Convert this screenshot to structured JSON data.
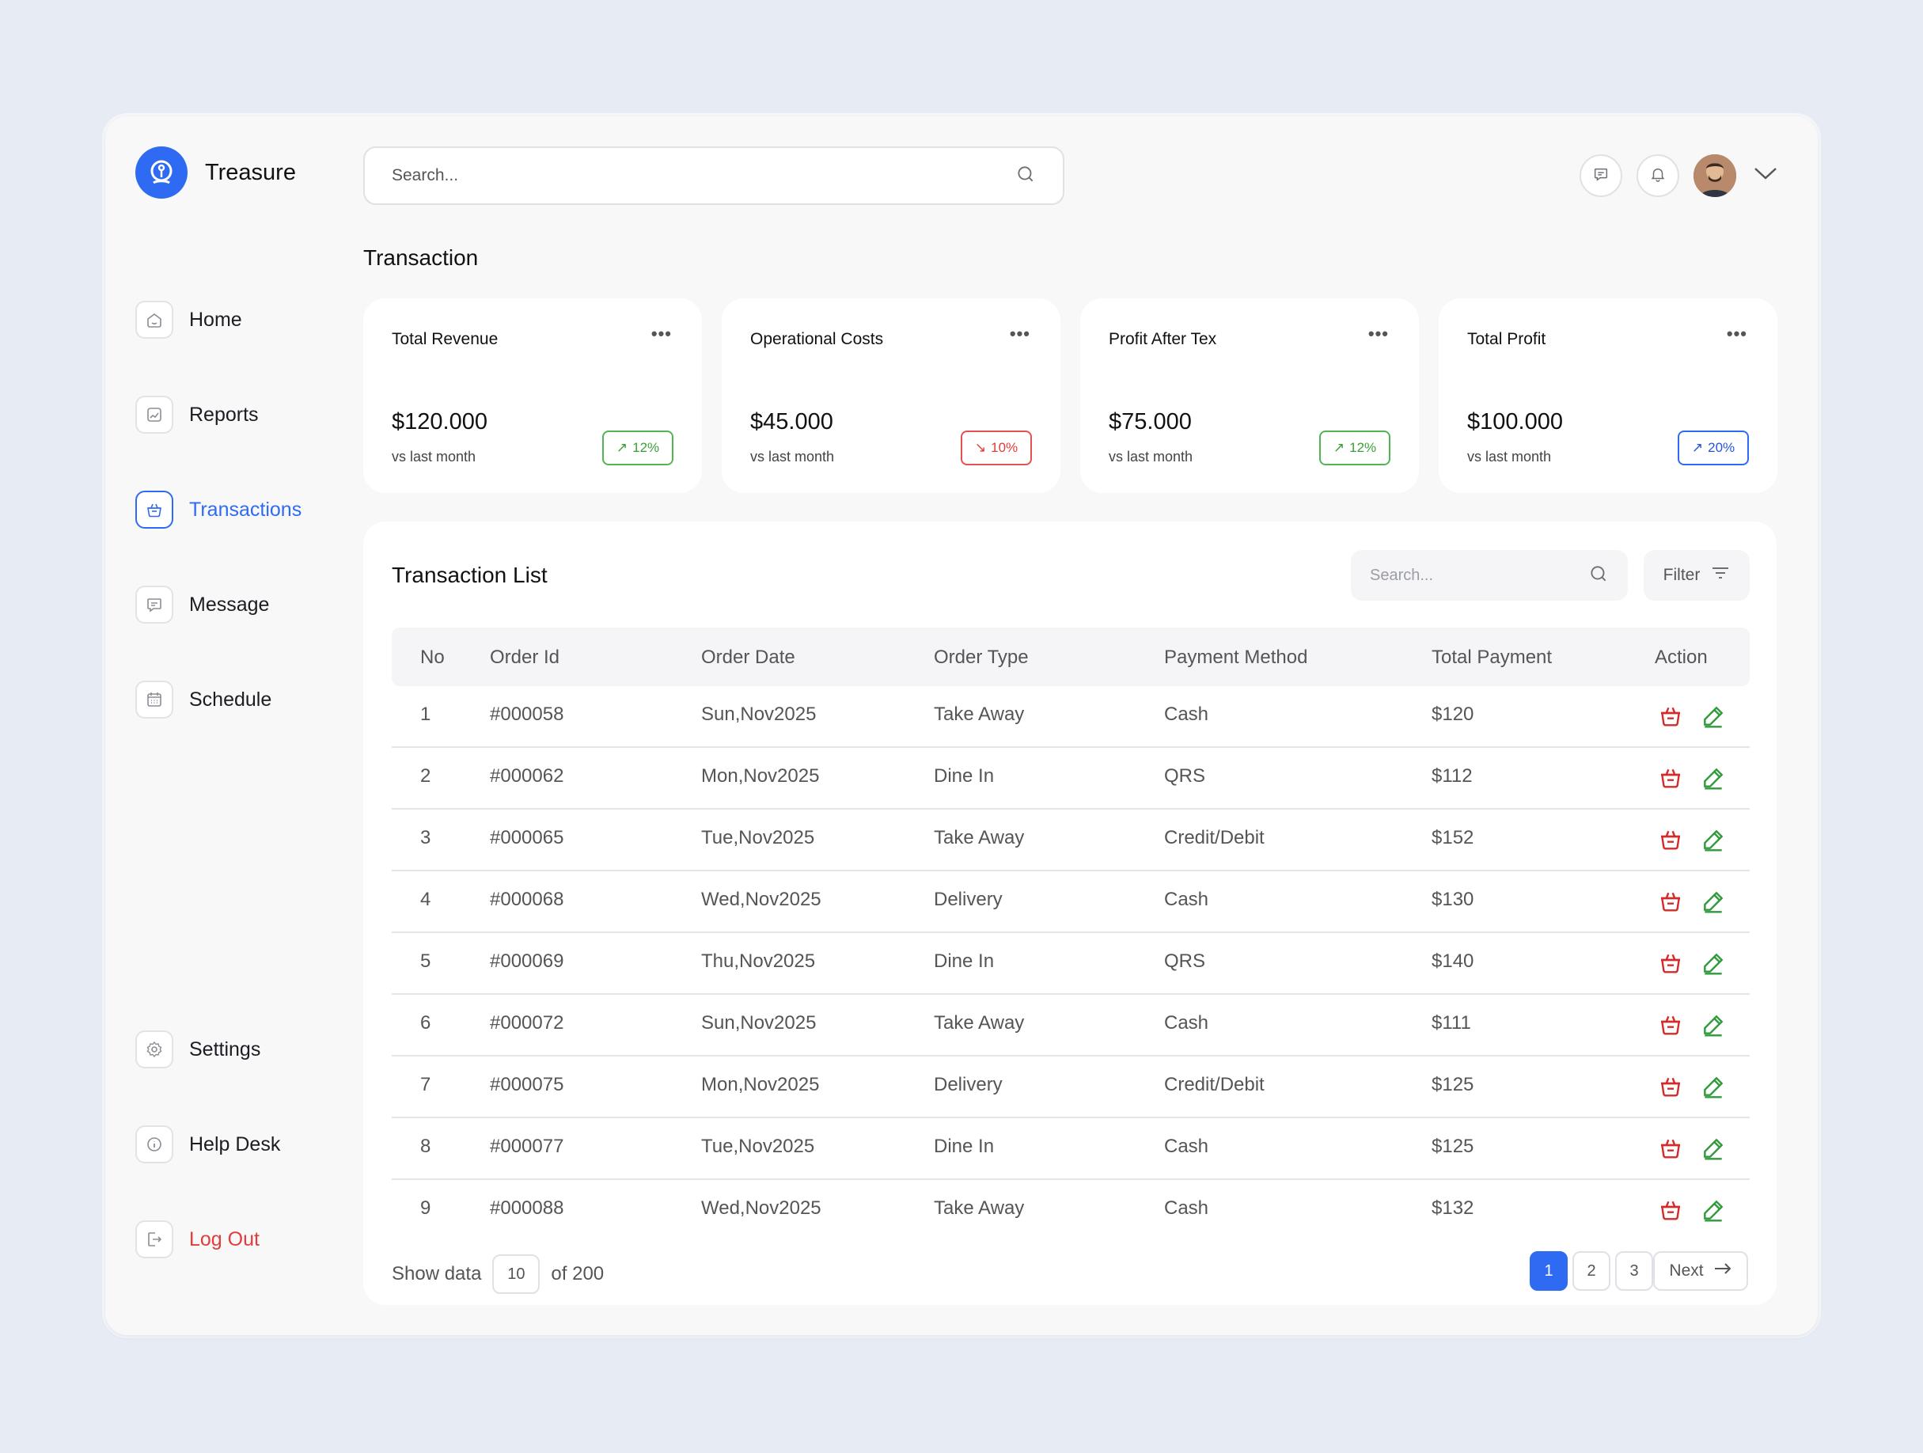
{
  "app": {
    "name": "Treasure"
  },
  "search": {
    "placeholder": "Search..."
  },
  "sidebar": {
    "items": [
      {
        "label": "Home"
      },
      {
        "label": "Reports"
      },
      {
        "label": "Transactions"
      },
      {
        "label": "Message"
      },
      {
        "label": "Schedule"
      },
      {
        "label": "Settings"
      },
      {
        "label": "Help Desk"
      },
      {
        "label": "Log Out"
      }
    ],
    "active": "Transactions"
  },
  "page": {
    "title": "Transaction"
  },
  "cards": [
    {
      "title": "Total Revenue",
      "value": "$120.000",
      "sub": "vs last month",
      "change": "12%",
      "trend": "up",
      "color": "#3aa13a"
    },
    {
      "title": "Operational Costs",
      "value": "$45.000",
      "sub": "vs last month",
      "change": "10%",
      "trend": "down",
      "color": "#e23b3b"
    },
    {
      "title": "Profit After Tex",
      "value": "$75.000",
      "sub": "vs last month",
      "change": "12%",
      "trend": "up",
      "color": "#3aa13a"
    },
    {
      "title": "Total Profit",
      "value": "$100.000",
      "sub": "vs last month",
      "change": "20%",
      "trend": "up",
      "color": "#2556d8"
    }
  ],
  "list": {
    "title": "Transaction List",
    "search_placeholder": "Search...",
    "filter_label": "Filter",
    "columns": [
      "No",
      "Order Id",
      "Order Date",
      "Order Type",
      "Payment Method",
      "Total Payment",
      "Action"
    ],
    "rows": [
      {
        "no": "1",
        "id": "#000058",
        "date": "Sun,Nov2025",
        "type": "Take Away",
        "method": "Cash",
        "total": "$120"
      },
      {
        "no": "2",
        "id": "#000062",
        "date": "Mon,Nov2025",
        "type": "Dine In",
        "method": "QRS",
        "total": "$112"
      },
      {
        "no": "3",
        "id": "#000065",
        "date": "Tue,Nov2025",
        "type": "Take Away",
        "method": "Credit/Debit",
        "total": "$152"
      },
      {
        "no": "4",
        "id": "#000068",
        "date": "Wed,Nov2025",
        "type": "Delivery",
        "method": "Cash",
        "total": "$130"
      },
      {
        "no": "5",
        "id": "#000069",
        "date": "Thu,Nov2025",
        "type": "Dine In",
        "method": "QRS",
        "total": "$140"
      },
      {
        "no": "6",
        "id": "#000072",
        "date": "Sun,Nov2025",
        "type": "Take Away",
        "method": "Cash",
        "total": "$111"
      },
      {
        "no": "7",
        "id": "#000075",
        "date": "Mon,Nov2025",
        "type": "Delivery",
        "method": "Credit/Debit",
        "total": "$125"
      },
      {
        "no": "8",
        "id": "#000077",
        "date": "Tue,Nov2025",
        "type": "Dine In",
        "method": "Cash",
        "total": "$125"
      },
      {
        "no": "9",
        "id": "#000088",
        "date": "Wed,Nov2025",
        "type": "Take Away",
        "method": "Cash",
        "total": "$132"
      }
    ],
    "show_data_label": "Show data",
    "page_size": "10",
    "total_label": "of 200",
    "pages": [
      "1",
      "2",
      "3"
    ],
    "current_page": "1",
    "next_label": "Next"
  },
  "icons": {
    "header": [
      "message-icon",
      "bell-icon"
    ],
    "row_actions": [
      "delete-icon",
      "edit-icon"
    ]
  },
  "colors": {
    "accent": "#2f6bf2",
    "danger": "#e23b3b",
    "edit": "#3aa13a"
  }
}
